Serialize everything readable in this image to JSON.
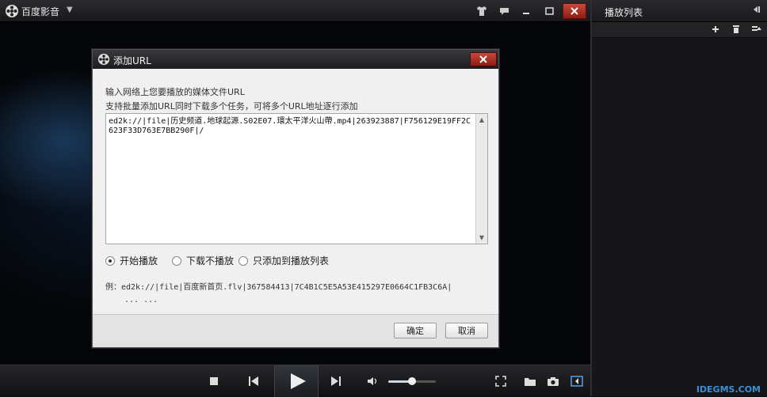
{
  "app": {
    "title": "百度影音"
  },
  "playlist": {
    "title": "播放列表"
  },
  "dialog": {
    "title": "添加URL",
    "desc1": "输入网络上您要播放的媒体文件URL",
    "desc2": "支持批量添加URL同时下载多个任务，可将多个URL地址逐行添加",
    "url_value": "ed2k://|file|历史频道.地球起源.S02E07.環太平洋火山帶.mp4|263923887|F756129E19FF2C623F33D763E7BB290F|/",
    "options": [
      "开始播放",
      "下载不播放",
      "只添加到播放列表"
    ],
    "selected_option": "开始播放",
    "example": "例：ed2k://|file|百度新首页.flv|367584413|7C4B1C5E5A53E415297E0664C1FB3C6A|",
    "example_cont": "... ...",
    "confirm_label": "确定",
    "cancel_label": "取消"
  },
  "volume": {
    "level": 0.5
  },
  "watermark": "IDEGMS.COM",
  "colors": {
    "close": "#a8281e",
    "accent": "#3a8fd6"
  }
}
